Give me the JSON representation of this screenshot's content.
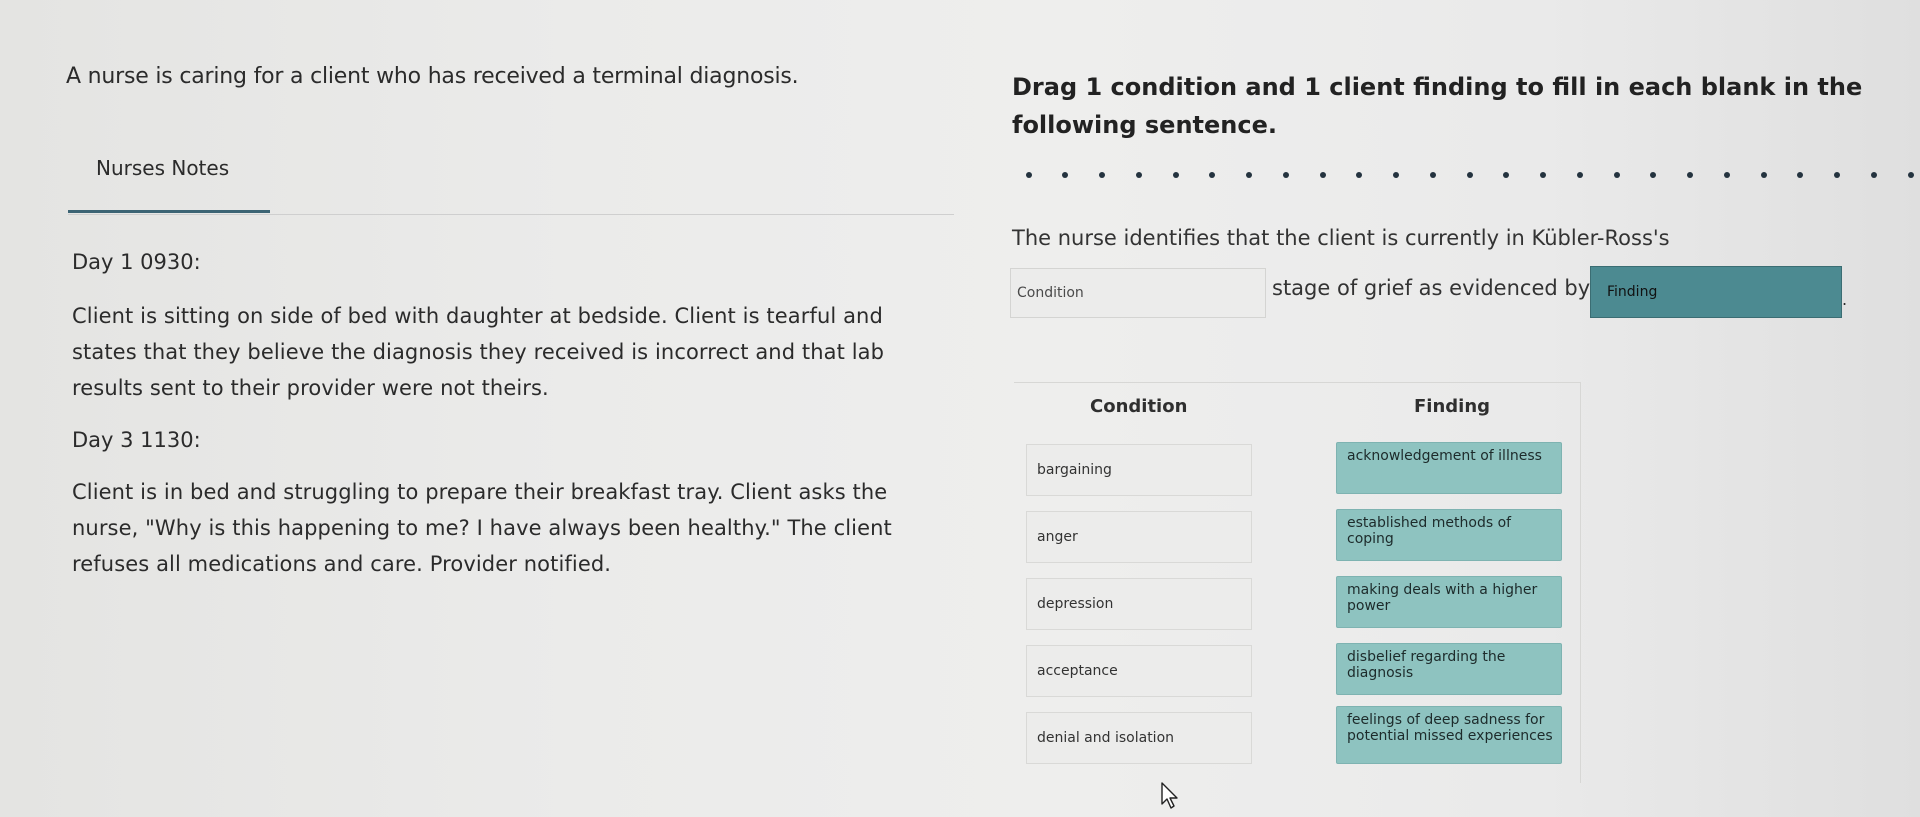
{
  "scenario": {
    "intro": "A nurse is caring for a client who has received a terminal diagnosis."
  },
  "notes": {
    "tab_label": "Nurses Notes",
    "entries": [
      {
        "time": "Day 1 0930:",
        "text": "Client is sitting on side of bed with daughter at bedside. Client is tearful and states that they believe the diagnosis they received is incorrect and that lab results sent to their provider were not theirs."
      },
      {
        "time": "Day 3 1130:",
        "text": "Client is in bed and struggling to prepare their breakfast tray. Client asks the nurse, \"Why is this happening to me? I have always been healthy.\" The client refuses all medications and care. Provider notified."
      }
    ]
  },
  "question": {
    "instruction": "Drag 1 condition and 1 client finding to fill in each blank in the following sentence.",
    "sentence_part1": "The nurse identifies that the client is currently in Kübler-Ross's",
    "sentence_part2": "stage of grief as evidenced by",
    "sentence_end": ".",
    "condition_placeholder": "Condition",
    "finding_placeholder": "Finding"
  },
  "options": {
    "condition_header": "Condition",
    "finding_header": "Finding",
    "conditions": [
      "bargaining",
      "anger",
      "depression",
      "acceptance",
      "denial and isolation"
    ],
    "findings": [
      "acknowledgement of illness",
      "established methods of coping",
      "making deals with a higher power",
      "disbelief regarding the diagnosis",
      "feelings of deep sadness for potential missed experiences"
    ]
  },
  "colors": {
    "accent": "#3c6474",
    "finding_filled": "#4c8a91",
    "finding_option": "#8ec3c0",
    "condition_option": "#ececeb"
  }
}
